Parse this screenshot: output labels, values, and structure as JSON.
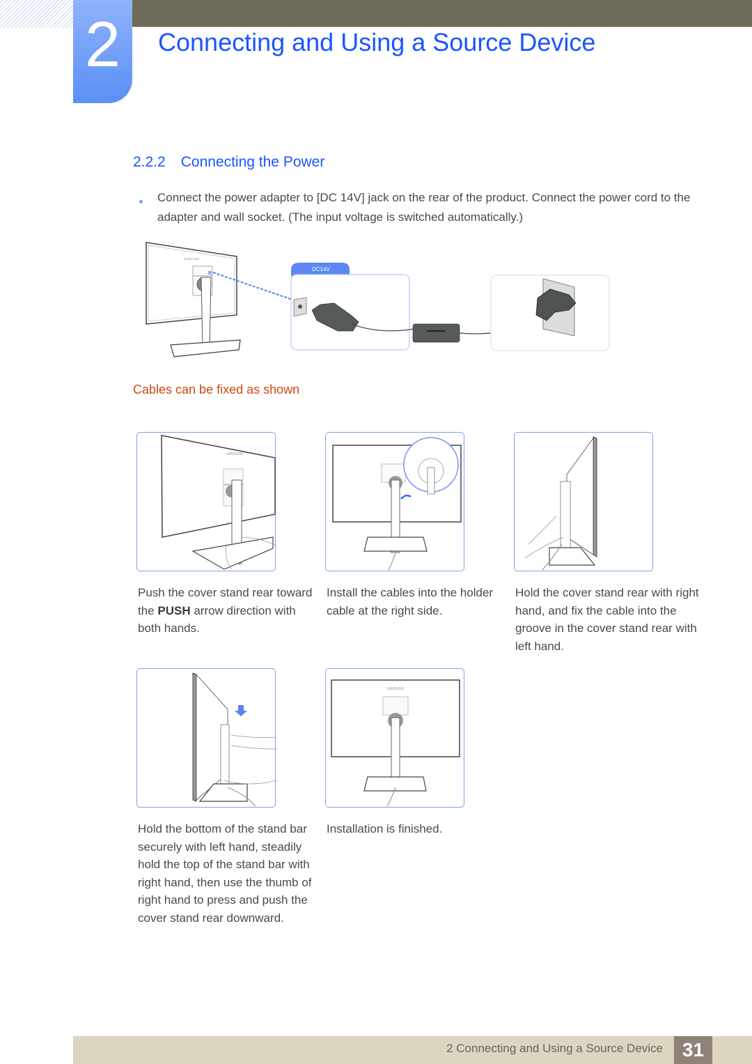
{
  "chapter": {
    "number": "2",
    "title": "Connecting and Using a Source Device"
  },
  "section": {
    "number": "2.2.2",
    "title": "Connecting the Power",
    "bullet_text": "Connect the power adapter to [DC 14V] jack on the rear of the product. Connect the power cord to the adapter and wall socket. (The input voltage is switched automatically.)"
  },
  "power_figure": {
    "jack_label": "DC14V",
    "brand_label": "SAMSUNG"
  },
  "cables": {
    "heading": "Cables can be fixed as shown",
    "steps": [
      {
        "caption_pre": "Push the cover stand rear toward the ",
        "caption_bold": "PUSH",
        "caption_post": " arrow direction with both hands."
      },
      {
        "caption": "Install the cables into the holder cable at the right side."
      },
      {
        "caption": "Hold the cover stand rear with right hand, and fix the cable into the groove in the cover stand rear with left hand."
      },
      {
        "caption": "Hold the bottom of the stand bar securely with left hand, steadily hold the top of the stand bar with right hand, then use the thumb of right hand to press and push the cover stand rear downward."
      },
      {
        "caption": "Installation is finished."
      }
    ]
  },
  "footer": {
    "text": "2 Connecting and Using a Source Device",
    "page": "31"
  },
  "colors": {
    "accent_blue": "#1a56ff",
    "subhead_orange": "#cc4a12",
    "frame_blue": "#7fa0f2",
    "top_bar": "#6e6b58",
    "footer_bg": "#dbd5c2",
    "page_badge": "#8e8175"
  }
}
